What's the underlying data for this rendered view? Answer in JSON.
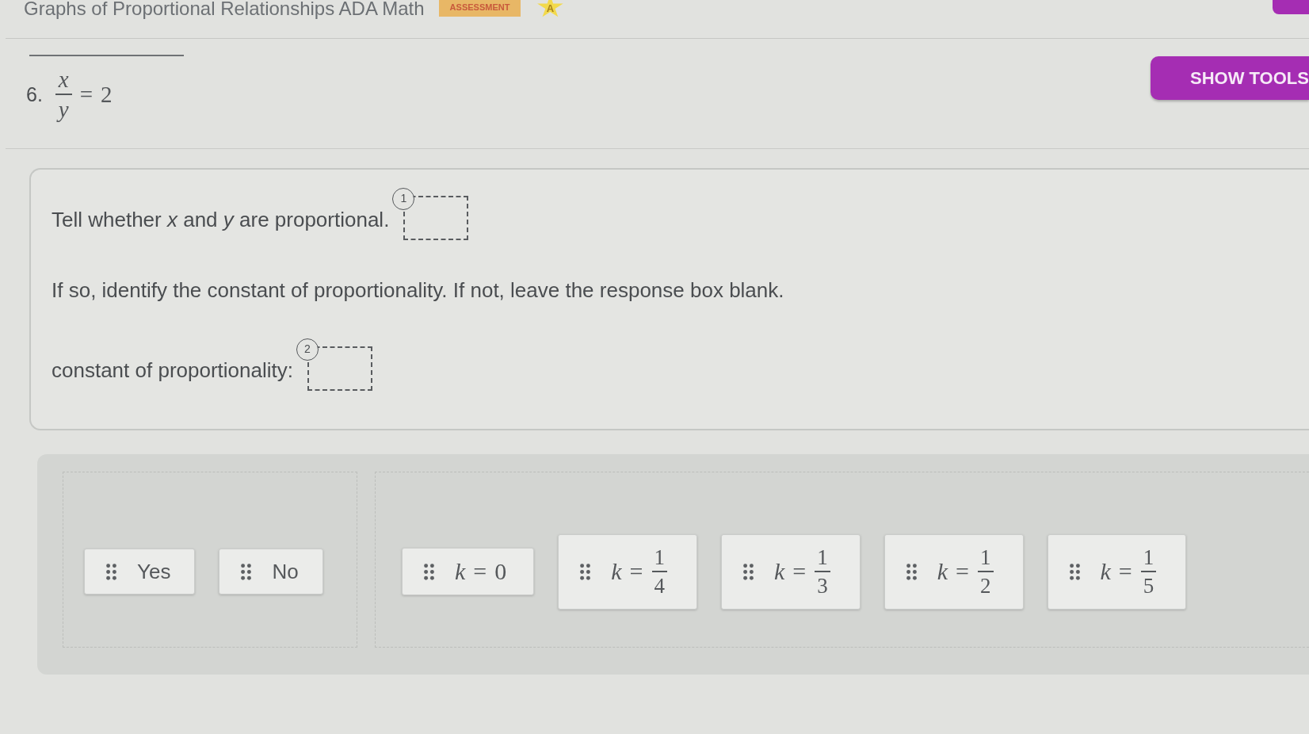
{
  "header": {
    "title": "Graphs of Proportional Relationships ADA Math",
    "badge": "ASSESSMENT",
    "star_label": "A"
  },
  "question": {
    "number": "6.",
    "equation": {
      "numerator": "x",
      "denominator": "y",
      "relation": "=",
      "rhs": "2"
    },
    "tools_button": "SHOW TOOLS"
  },
  "prompt": {
    "lines": [
      {
        "kind": "drop",
        "text": "Tell whether *x* and *y* are proportional.",
        "zone": "1"
      },
      {
        "kind": "text",
        "text": "If so, identify the constant of proportionality. If not, leave the response box blank."
      },
      {
        "kind": "drop",
        "text": "constant of proportionality:",
        "zone": "2"
      }
    ]
  },
  "answer_bank": {
    "groups": [
      {
        "tiles": [
          {
            "kind": "text",
            "label": "Yes"
          },
          {
            "kind": "text",
            "label": "No"
          }
        ]
      },
      {
        "tiles": [
          {
            "kind": "equation",
            "lhs": "k",
            "relation": "=",
            "rhs": "0"
          },
          {
            "kind": "fraction",
            "lhs": "k",
            "relation": "=",
            "numerator": "1",
            "denominator": "4"
          },
          {
            "kind": "fraction",
            "lhs": "k",
            "relation": "=",
            "numerator": "1",
            "denominator": "3"
          },
          {
            "kind": "fraction",
            "lhs": "k",
            "relation": "=",
            "numerator": "1",
            "denominator": "2"
          },
          {
            "kind": "fraction",
            "lhs": "k",
            "relation": "=",
            "numerator": "1",
            "denominator": "5"
          }
        ]
      }
    ]
  }
}
